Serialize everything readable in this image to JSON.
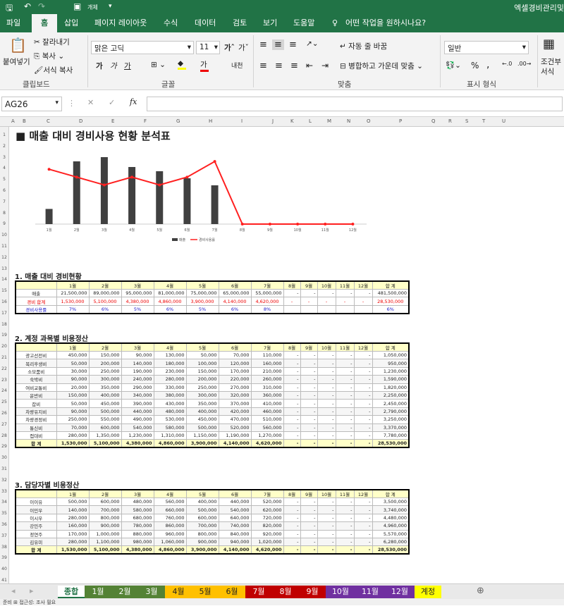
{
  "window": {
    "title": "엑셀경비관리및",
    "quick_access": [
      "save-icon",
      "undo-icon",
      "redo-icon",
      "camera-icon",
      "pointer-icon",
      "customize-icon"
    ],
    "qa_label": "개체"
  },
  "ribbon_tabs": [
    "파일",
    "홈",
    "삽입",
    "페이지 레이아웃",
    "수식",
    "데이터",
    "검토",
    "보기",
    "도움말"
  ],
  "tell_me": "어떤 작업을 원하시나요?",
  "ribbon": {
    "clipboard": {
      "paste": "붙여넣기",
      "cut": "잘라내기",
      "copy": "복사",
      "format_painter": "서식 복사",
      "group": "클립보드"
    },
    "font": {
      "name": "맑은 고딕",
      "size": "11",
      "group": "글꼴",
      "bold": "가",
      "italic": "가",
      "underline": "가",
      "phonetic": "내천"
    },
    "align": {
      "wrap": "자동 줄 바꿈",
      "merge": "병합하고 가운데 맞춤",
      "group": "맞춤"
    },
    "number": {
      "format": "일반",
      "percent": "%",
      "comma": ",",
      "group": "표시 형식"
    },
    "styles": {
      "cond": "조건부",
      "cond2": "서식"
    }
  },
  "formula_bar": {
    "name_box": "AG26",
    "fx": "fx",
    "value": ""
  },
  "columns": [
    "A",
    "B",
    "C",
    "D",
    "E",
    "F",
    "G",
    "H",
    "I",
    "J",
    "K",
    "L",
    "M",
    "N",
    "O",
    "P",
    "Q",
    "R",
    "S",
    "T",
    "U"
  ],
  "rows": [
    "1",
    "2",
    "3",
    "4",
    "5",
    "6",
    "7",
    "8",
    "9",
    "10",
    "11",
    "12",
    "13",
    "14",
    "15",
    "16",
    "17",
    "18",
    "19",
    "20",
    "21",
    "22",
    "23",
    "24",
    "25",
    "26",
    "27",
    "28",
    "29",
    "30",
    "31",
    "32",
    "33",
    "34",
    "35",
    "36",
    "37",
    "38",
    "39",
    "40",
    "41"
  ],
  "page_title": "■ 매출 대비 경비사용 현황 분석표",
  "chart_data": {
    "type": "bar",
    "categories": [
      "1월",
      "2월",
      "3월",
      "4월",
      "5월",
      "6월",
      "7월",
      "8월",
      "9월",
      "10월",
      "11월",
      "12월"
    ],
    "series": [
      {
        "name": "매출",
        "type": "bar",
        "color": "#404040",
        "values": [
          21500000,
          89000000,
          95000000,
          81000000,
          75000000,
          65000000,
          55000000,
          0,
          0,
          0,
          0,
          0
        ]
      },
      {
        "name": "경비사용률",
        "type": "line",
        "color": "#ff2020",
        "values": [
          7,
          6,
          5,
          6,
          5,
          6,
          8,
          0,
          0,
          0,
          0,
          0
        ]
      }
    ],
    "legend": "bottom"
  },
  "months": [
    "1월",
    "2월",
    "3월",
    "4월",
    "5월",
    "6월",
    "7월",
    "8월",
    "9월",
    "10월",
    "11월",
    "12월"
  ],
  "total_label": "합 계",
  "sec1": {
    "title": "1. 매출 대비 경비현황",
    "rows": [
      {
        "label": "매출",
        "values": [
          "21,500,000",
          "89,000,000",
          "95,000,000",
          "81,000,000",
          "75,000,000",
          "65,000,000",
          "55,000,000",
          "-",
          "-",
          "-",
          "-",
          "-"
        ],
        "total": "481,500,000",
        "style": ""
      },
      {
        "label": "경비 합계",
        "values": [
          "1,530,000",
          "5,100,000",
          "4,380,000",
          "4,860,000",
          "3,900,000",
          "4,140,000",
          "4,620,000",
          "-",
          "-",
          "-",
          "-",
          "-"
        ],
        "total": "28,530,000",
        "style": "red"
      },
      {
        "label": "경비사용률",
        "values": [
          "7%",
          "6%",
          "5%",
          "6%",
          "5%",
          "6%",
          "8%",
          "",
          "",
          "",
          "",
          ""
        ],
        "total": "6%",
        "style": "blue"
      }
    ]
  },
  "sec2": {
    "title": "2. 계정 과목별 비용정산",
    "rows": [
      {
        "label": "광고선전비",
        "values": [
          "450,000",
          "150,000",
          "90,000",
          "130,000",
          "50,000",
          "70,000",
          "110,000",
          "-",
          "-",
          "-",
          "-",
          "-"
        ],
        "total": "1,050,000"
      },
      {
        "label": "복리후생비",
        "values": [
          "50,000",
          "200,000",
          "140,000",
          "180,000",
          "100,000",
          "120,000",
          "160,000",
          "-",
          "-",
          "-",
          "-",
          "-"
        ],
        "total": "950,000"
      },
      {
        "label": "소모품비",
        "values": [
          "30,000",
          "250,000",
          "190,000",
          "230,000",
          "150,000",
          "170,000",
          "210,000",
          "-",
          "-",
          "-",
          "-",
          "-"
        ],
        "total": "1,230,000"
      },
      {
        "label": "숙박비",
        "values": [
          "90,000",
          "300,000",
          "240,000",
          "280,000",
          "200,000",
          "220,000",
          "260,000",
          "-",
          "-",
          "-",
          "-",
          "-"
        ],
        "total": "1,590,000"
      },
      {
        "label": "여비교통비",
        "values": [
          "20,000",
          "350,000",
          "290,000",
          "330,000",
          "250,000",
          "270,000",
          "310,000",
          "-",
          "-",
          "-",
          "-",
          "-"
        ],
        "total": "1,820,000"
      },
      {
        "label": "운반비",
        "values": [
          "150,000",
          "400,000",
          "340,000",
          "380,000",
          "300,000",
          "320,000",
          "360,000",
          "-",
          "-",
          "-",
          "-",
          "-"
        ],
        "total": "2,250,000"
      },
      {
        "label": "잡비",
        "values": [
          "50,000",
          "450,000",
          "390,000",
          "430,000",
          "350,000",
          "370,000",
          "410,000",
          "-",
          "-",
          "-",
          "-",
          "-"
        ],
        "total": "2,450,000"
      },
      {
        "label": "차량유지비",
        "values": [
          "90,000",
          "500,000",
          "440,000",
          "480,000",
          "400,000",
          "420,000",
          "460,000",
          "-",
          "-",
          "-",
          "-",
          "-"
        ],
        "total": "2,790,000"
      },
      {
        "label": "차량경정비",
        "values": [
          "250,000",
          "550,000",
          "490,000",
          "530,000",
          "450,000",
          "470,000",
          "510,000",
          "-",
          "-",
          "-",
          "-",
          "-"
        ],
        "total": "3,250,000"
      },
      {
        "label": "통신비",
        "values": [
          "70,000",
          "600,000",
          "540,000",
          "580,000",
          "500,000",
          "520,000",
          "560,000",
          "-",
          "-",
          "-",
          "-",
          "-"
        ],
        "total": "3,370,000"
      },
      {
        "label": "접대비",
        "values": [
          "280,000",
          "1,350,000",
          "1,230,000",
          "1,310,000",
          "1,150,000",
          "1,190,000",
          "1,270,000",
          "-",
          "-",
          "-",
          "-",
          "-"
        ],
        "total": "7,780,000"
      }
    ],
    "totals": {
      "label": "합 계",
      "values": [
        "1,530,000",
        "5,100,000",
        "4,380,000",
        "4,860,000",
        "3,900,000",
        "4,140,000",
        "4,620,000",
        "-",
        "-",
        "-",
        "-",
        "-"
      ],
      "total": "28,530,000"
    }
  },
  "sec3": {
    "title": "3. 담당자별 비용정산",
    "rows": [
      {
        "label": "이이유",
        "values": [
          "500,000",
          "600,000",
          "480,000",
          "560,000",
          "400,000",
          "440,000",
          "520,000",
          "-",
          "-",
          "-",
          "-",
          "-"
        ],
        "total": "3,500,000"
      },
      {
        "label": "이민우",
        "values": [
          "140,000",
          "700,000",
          "580,000",
          "660,000",
          "500,000",
          "540,000",
          "620,000",
          "-",
          "-",
          "-",
          "-",
          "-"
        ],
        "total": "3,740,000"
      },
      {
        "label": "이시우",
        "values": [
          "280,000",
          "800,000",
          "680,000",
          "760,000",
          "600,000",
          "640,000",
          "720,000",
          "-",
          "-",
          "-",
          "-",
          "-"
        ],
        "total": "4,480,000"
      },
      {
        "label": "강민주",
        "values": [
          "160,000",
          "900,000",
          "780,000",
          "860,000",
          "700,000",
          "740,000",
          "820,000",
          "-",
          "-",
          "-",
          "-",
          "-"
        ],
        "total": "4,960,000"
      },
      {
        "label": "정연주",
        "values": [
          "170,000",
          "1,000,000",
          "880,000",
          "960,000",
          "800,000",
          "840,000",
          "920,000",
          "-",
          "-",
          "-",
          "-",
          "-"
        ],
        "total": "5,570,000"
      },
      {
        "label": "김유미",
        "values": [
          "280,000",
          "1,100,000",
          "980,000",
          "1,060,000",
          "900,000",
          "940,000",
          "1,020,000",
          "-",
          "-",
          "-",
          "-",
          "-"
        ],
        "total": "6,280,000"
      }
    ],
    "totals": {
      "label": "합 계",
      "values": [
        "1,530,000",
        "5,100,000",
        "4,380,000",
        "4,860,000",
        "3,900,000",
        "4,140,000",
        "4,620,000",
        "-",
        "-",
        "-",
        "-",
        "-"
      ],
      "total": "28,530,000"
    }
  },
  "sheet_tabs": [
    {
      "label": "종합",
      "color": "#ffffff",
      "text": "#217346",
      "active": true
    },
    {
      "label": "1월",
      "color": "#548235",
      "text": "#ffffff"
    },
    {
      "label": "2월",
      "color": "#548235",
      "text": "#ffffff"
    },
    {
      "label": "3월",
      "color": "#548235",
      "text": "#ffffff"
    },
    {
      "label": "4월",
      "color": "#ffc000",
      "text": "#222222"
    },
    {
      "label": "5월",
      "color": "#ffc000",
      "text": "#222222"
    },
    {
      "label": "6월",
      "color": "#ffc000",
      "text": "#222222"
    },
    {
      "label": "7월",
      "color": "#c00000",
      "text": "#ffffff"
    },
    {
      "label": "8월",
      "color": "#c00000",
      "text": "#ffffff"
    },
    {
      "label": "9월",
      "color": "#c00000",
      "text": "#ffffff"
    },
    {
      "label": "10월",
      "color": "#7030a0",
      "text": "#ffffff"
    },
    {
      "label": "11월",
      "color": "#7030a0",
      "text": "#ffffff"
    },
    {
      "label": "12월",
      "color": "#7030a0",
      "text": "#ffffff"
    },
    {
      "label": "계정",
      "color": "#ffff00",
      "text": "#222222"
    }
  ],
  "status": "준비 ⊞ 접근성: 조사 필요"
}
